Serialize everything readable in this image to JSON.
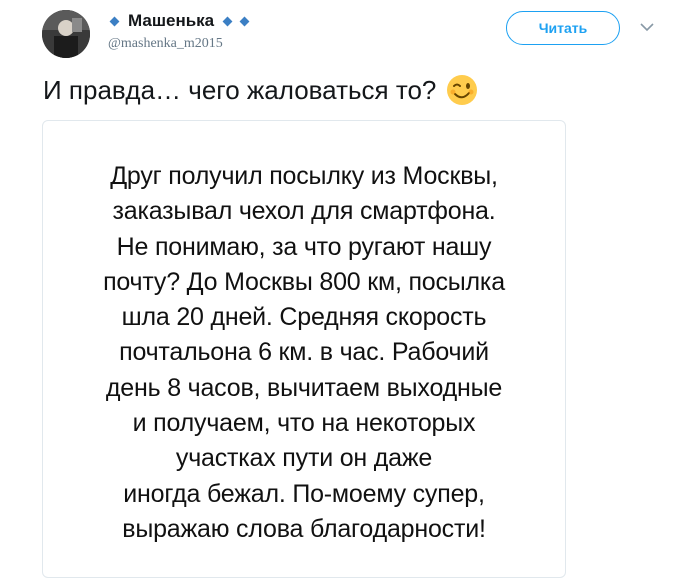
{
  "author": {
    "display_name": "Машенька",
    "handle": "@mashenka_m2015"
  },
  "follow_button": {
    "label": "Читать"
  },
  "tweet": {
    "text": "И правда… чего жаловаться то?",
    "emoji": "winking-face"
  },
  "image_text_lines": [
    "Друг получил посылку из Москвы,",
    "заказывал чехол для смартфона.",
    "Не понимаю, за что ругают нашу",
    "почту? До Москвы 800 км, посылка",
    "шла 20 дней. Средняя скорость",
    "почтальона 6 км. в час. Рабочий",
    "день 8 часов, вычитаем выходные",
    "и получаем, что на некоторых",
    "участках пути он даже",
    "иногда бежал. По-моему супер,",
    "выражаю слова благодарности!"
  ],
  "colors": {
    "accent": "#1da1f2",
    "diamond": "#3b7fc4",
    "secondary_text": "#657786"
  }
}
